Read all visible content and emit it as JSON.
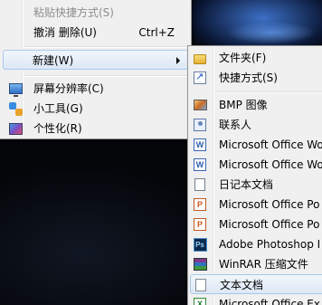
{
  "context_menu": {
    "paste_shortcut": "粘贴快捷方式(S)",
    "undo_delete": "撤消 删除(U)",
    "undo_shortcut": "Ctrl+Z",
    "new": "新建(W)",
    "screen_resolution": "屏幕分辨率(C)",
    "gadgets": "小工具(G)",
    "personalize": "个性化(R)"
  },
  "new_submenu": {
    "folder": "文件夹(F)",
    "shortcut": "快捷方式(S)",
    "bmp": "BMP 图像",
    "contact": "联系人",
    "office_word_1": "Microsoft Office Wo",
    "office_word_2": "Microsoft Office Wo",
    "journal": "日记本文档",
    "office_ppt_1": "Microsoft Office Po",
    "office_ppt_2": "Microsoft Office Po",
    "photoshop": "Adobe Photoshop I",
    "winrar": "WinRAR 压缩文件",
    "text_doc": "文本文档",
    "office_excel": "Microsoft Office Ex"
  },
  "icons": {
    "folder": "folder-icon",
    "shortcut": "shortcut-icon",
    "bmp": "bmp-image-icon",
    "contact": "contact-icon",
    "word": "word-document-icon",
    "journal": "journal-document-icon",
    "ppt": "powerpoint-icon",
    "photoshop": "photoshop-icon",
    "winrar": "winrar-archive-icon",
    "text": "text-document-icon",
    "excel": "excel-icon",
    "screen_resolution": "monitor-icon",
    "gadgets": "gadgets-icon",
    "personalize": "personalize-icon"
  },
  "colors": {
    "menu_bg": "#f0f0f0",
    "hover_border": "#a8c8ec",
    "disabled_text": "#8d8d8d"
  }
}
